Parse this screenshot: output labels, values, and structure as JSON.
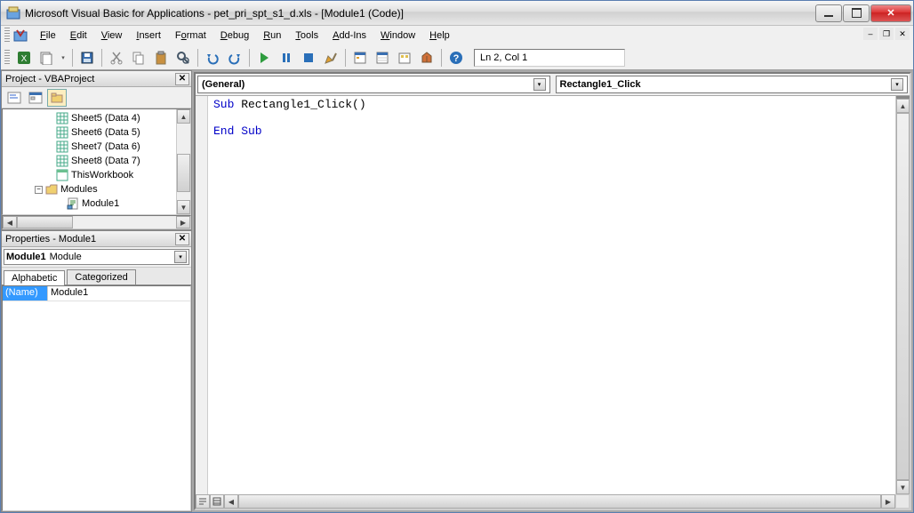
{
  "title": "Microsoft Visual Basic for Applications - pet_pri_spt_s1_d.xls - [Module1 (Code)]",
  "menu": {
    "file": "File",
    "edit": "Edit",
    "view": "View",
    "insert": "Insert",
    "format": "Format",
    "debug": "Debug",
    "run": "Run",
    "tools": "Tools",
    "addins": "Add-Ins",
    "window": "Window",
    "help": "Help"
  },
  "toolbar": {
    "cursor_status": "Ln 2, Col 1"
  },
  "project_panel": {
    "title": "Project - VBAProject",
    "items": {
      "sheet5": "Sheet5 (Data 4)",
      "sheet6": "Sheet6 (Data 5)",
      "sheet7": "Sheet7 (Data 6)",
      "sheet8": "Sheet8 (Data 7)",
      "thiswb": "ThisWorkbook",
      "modules": "Modules",
      "module1": "Module1"
    }
  },
  "props_panel": {
    "title": "Properties - Module1",
    "object_name": "Module1",
    "object_type": "Module",
    "tabs": {
      "alpha": "Alphabetic",
      "cat": "Categorized"
    },
    "rows": {
      "name_label": "(Name)",
      "name_value": "Module1"
    }
  },
  "code": {
    "combo_left": "(General)",
    "combo_right": "Rectangle1_Click",
    "l1_kw": "Sub",
    "l1_rest": " Rectangle1_Click()",
    "l3": "End Sub"
  }
}
